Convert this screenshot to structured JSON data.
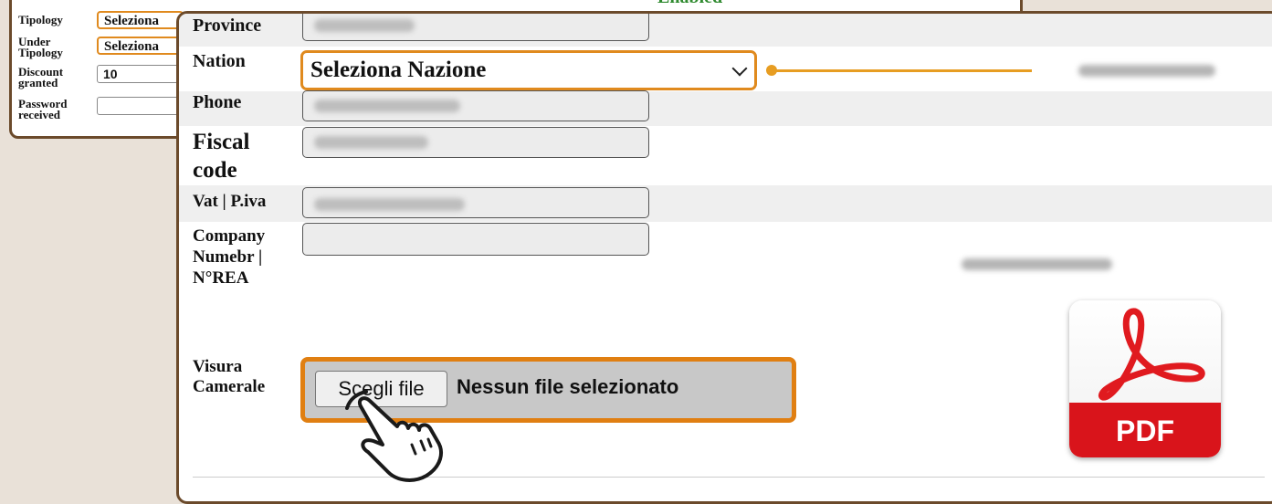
{
  "background_form": {
    "status_text": "Enabled",
    "rows": [
      {
        "label": "Tipology",
        "value": "Seleziona"
      },
      {
        "label": "Under Tipology",
        "value": "Seleziona"
      },
      {
        "label": "Discount granted",
        "value": "10"
      },
      {
        "label": "Password received",
        "value": ""
      }
    ]
  },
  "form": {
    "province": {
      "label": "Province"
    },
    "nation": {
      "label": "Nation",
      "selected": "Seleziona Nazione"
    },
    "phone": {
      "label": "Phone"
    },
    "fiscal_code": {
      "label": "Fiscal code"
    },
    "vat": {
      "label": "Vat | P.iva"
    },
    "company_number": {
      "label": "Company Numebr | N°REA"
    },
    "visura": {
      "label": "Visura Camerale",
      "button": "Scegli file",
      "status": "Nessun file selezionato"
    }
  },
  "pdf_icon": {
    "text": "PDF"
  },
  "colors": {
    "accent_orange": "#e08a1e",
    "frame_brown": "#6b4a2b",
    "pdf_red": "#d9141b"
  }
}
